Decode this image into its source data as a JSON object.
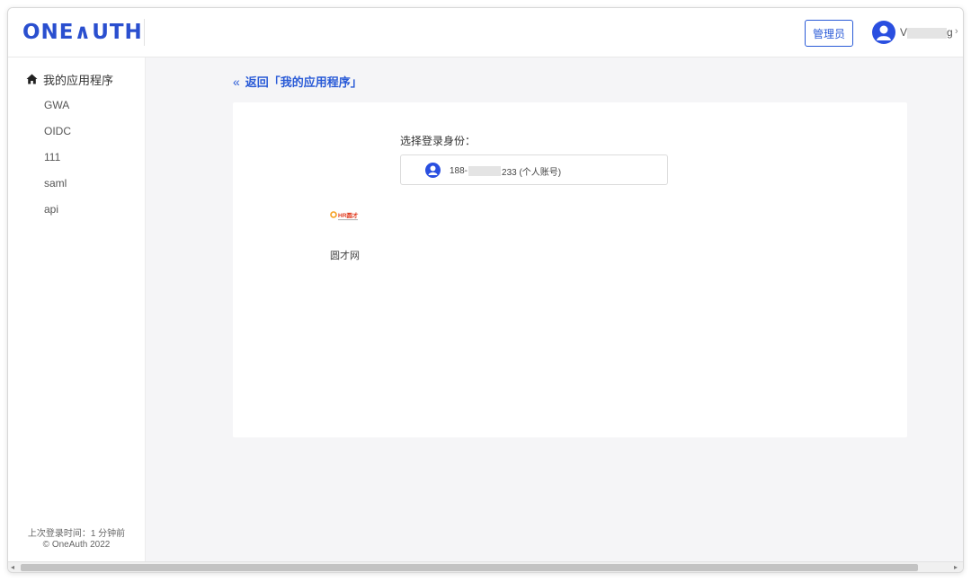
{
  "header": {
    "logo_text": "ONE∧UTH",
    "admin_button": "管理员",
    "user_name_start": "V",
    "user_name_end": "g",
    "chevron": "›"
  },
  "sidebar": {
    "home_label": "我的应用程序",
    "items": [
      {
        "label": "GWA"
      },
      {
        "label": "OIDC"
      },
      {
        "label": "111"
      },
      {
        "label": "saml"
      },
      {
        "label": "api"
      }
    ],
    "last_login": "上次登录时间：1 分钟前",
    "copyright": "© OneAuth 2022"
  },
  "main": {
    "back_icon": "«",
    "back_label": "返回「我的应用程序」",
    "select_identity_label": "选择登录身份：",
    "identity": {
      "prefix": "188-",
      "suffix": "233 (个人账号)"
    },
    "app_name": "圆才网",
    "app_logo_text": "HR圆才",
    "colors": {
      "accent": "#2a5bd7",
      "logo_blue": "#2a4fcf",
      "logo_red": "#e03a1e",
      "logo_orange": "#f5a020"
    }
  },
  "scrollbar": {
    "left_arrow": "◂",
    "right_arrow": "▸"
  }
}
